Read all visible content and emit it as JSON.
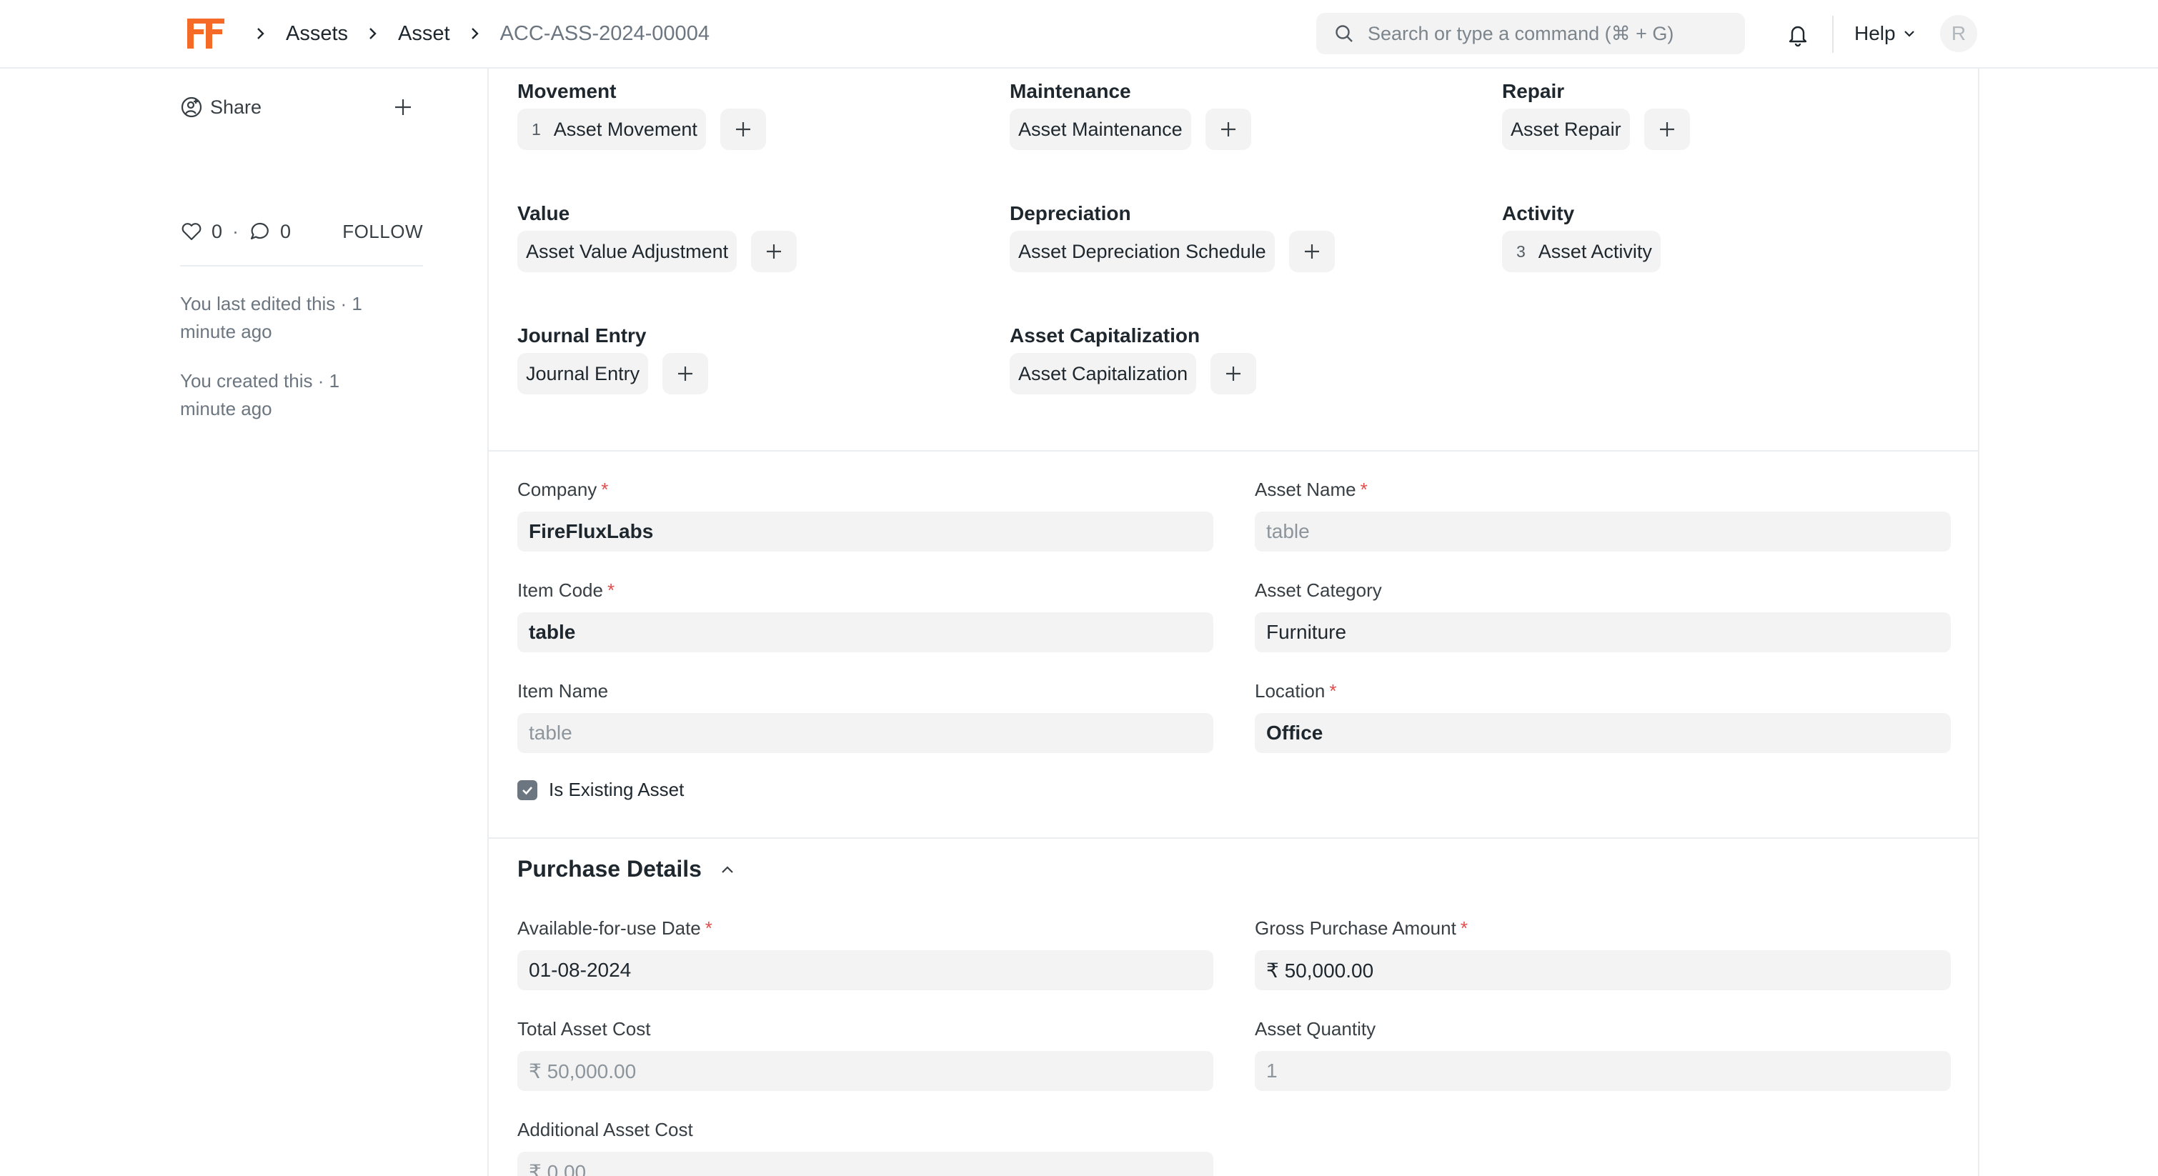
{
  "navbar": {
    "breadcrumbs": [
      "Assets",
      "Asset",
      "ACC-ASS-2024-00004"
    ],
    "search_placeholder": "Search or type a command (⌘ + G)",
    "help_label": "Help",
    "avatar_initial": "R"
  },
  "sidebar": {
    "share_label": "Share",
    "likes_count": "0",
    "comments_count": "0",
    "follow_label": "FOLLOW",
    "last_edited": "You last edited this · 1 minute ago",
    "created": "You created this · 1 minute ago"
  },
  "connections": [
    {
      "title": "Movement",
      "doc": "Asset Movement",
      "count": "1"
    },
    {
      "title": "Maintenance",
      "doc": "Asset Maintenance",
      "count": ""
    },
    {
      "title": "Repair",
      "doc": "Asset Repair",
      "count": ""
    },
    {
      "title": "Value",
      "doc": "Asset Value Adjustment",
      "count": ""
    },
    {
      "title": "Depreciation",
      "doc": "Asset Depreciation Schedule",
      "count": ""
    },
    {
      "title": "Activity",
      "doc": "Asset Activity",
      "count": "3"
    },
    {
      "title": "Journal Entry",
      "doc": "Journal Entry",
      "count": ""
    },
    {
      "title": "Asset Capitalization",
      "doc": "Asset Capitalization",
      "count": ""
    }
  ],
  "details": {
    "company": {
      "label": "Company",
      "value": "FireFluxLabs"
    },
    "asset_name": {
      "label": "Asset Name",
      "value": "table"
    },
    "item_code": {
      "label": "Item Code",
      "value": "table"
    },
    "asset_category": {
      "label": "Asset Category",
      "value": "Furniture"
    },
    "item_name": {
      "label": "Item Name",
      "value": "table"
    },
    "location": {
      "label": "Location",
      "value": "Office"
    },
    "is_existing_asset": {
      "label": "Is Existing Asset",
      "checked": true
    }
  },
  "purchase": {
    "section_title": "Purchase Details",
    "available_date": {
      "label": "Available-for-use Date",
      "value": "01-08-2024"
    },
    "gross_amount": {
      "label": "Gross Purchase Amount",
      "value": "₹ 50,000.00"
    },
    "total_cost": {
      "label": "Total Asset Cost",
      "value": "₹ 50,000.00"
    },
    "quantity": {
      "label": "Asset Quantity",
      "value": "1"
    },
    "additional_cost": {
      "label": "Additional Asset Cost",
      "value": "₹ 0.00"
    }
  },
  "colors": {
    "brand": "#f46a26",
    "required": "#e24c4c",
    "field_bg": "#f3f3f3"
  }
}
